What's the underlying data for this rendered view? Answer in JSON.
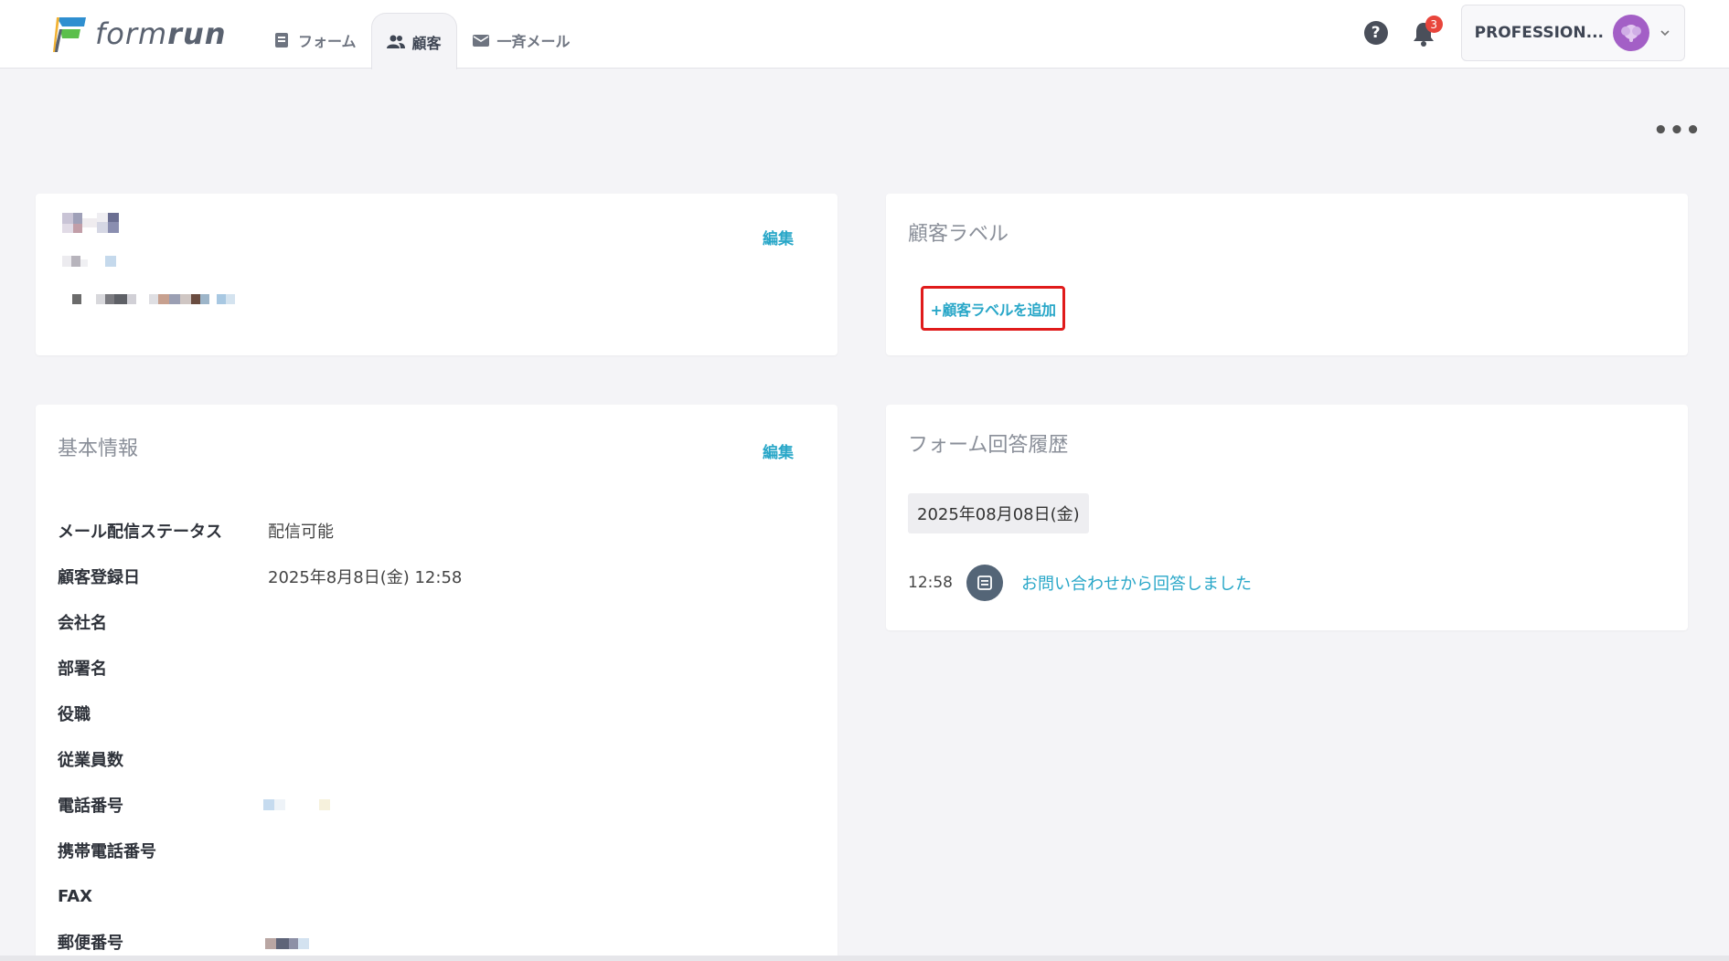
{
  "app": {
    "logo_text": "formrun",
    "nav": [
      {
        "label": "フォーム",
        "icon": "form-icon"
      },
      {
        "label": "顧客",
        "icon": "users-icon"
      },
      {
        "label": "一斉メール",
        "icon": "mail-icon"
      }
    ],
    "help_icon_glyph": "?",
    "notification_count": "3",
    "account_name": "PROFESSION...",
    "more_glyph": "•••",
    "colors": {
      "accent": "#29a7c8",
      "highlight": "#e01b1b",
      "avatar": "#a35fc6"
    }
  },
  "profile": {
    "edit_label": "編集"
  },
  "labels_card": {
    "title": "顧客ラベル",
    "add_label": "+顧客ラベルを追加"
  },
  "info_card": {
    "title": "基本情報",
    "edit_label": "編集",
    "rows": [
      {
        "label": "メール配信ステータス",
        "value": "配信可能"
      },
      {
        "label": "顧客登録日",
        "value": "2025年8月8日(金) 12:58"
      },
      {
        "label": "会社名",
        "value": ""
      },
      {
        "label": "部署名",
        "value": ""
      },
      {
        "label": "役職",
        "value": ""
      },
      {
        "label": "従業員数",
        "value": ""
      },
      {
        "label": "電話番号",
        "value": ""
      },
      {
        "label": "携帯電話番号",
        "value": ""
      },
      {
        "label": "FAX",
        "value": ""
      },
      {
        "label": "郵便番号",
        "value": ""
      }
    ]
  },
  "history_card": {
    "title": "フォーム回答履歴",
    "date": "2025年08月08日(金)",
    "entries": [
      {
        "time": "12:58",
        "text": "お問い合わせから回答しました",
        "icon": "form-icon"
      }
    ]
  }
}
